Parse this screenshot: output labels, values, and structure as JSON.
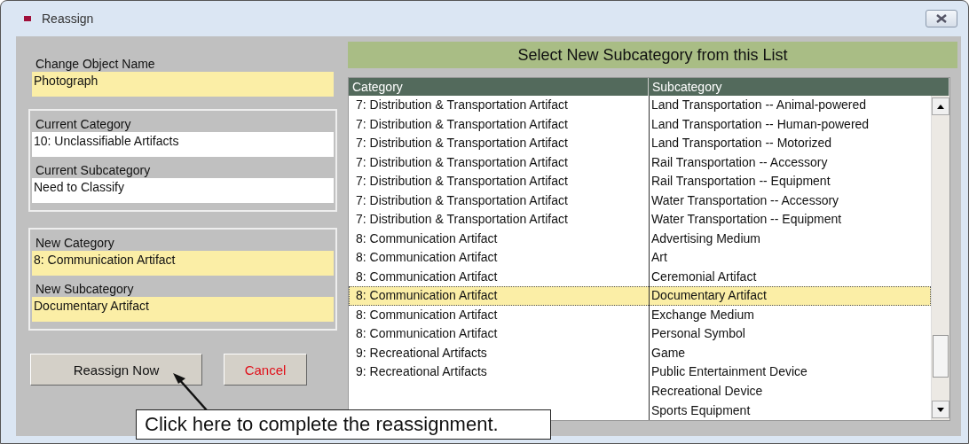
{
  "window": {
    "title": "Reassign"
  },
  "object_name": {
    "label": "Change Object Name",
    "value": "Photograph"
  },
  "current": {
    "category_label": "Current Category",
    "category": "10: Unclassifiable Artifacts",
    "subcategory_label": "Current Subcategory",
    "subcategory": "Need to Classify"
  },
  "new": {
    "category_label": "New Category",
    "category": "8: Communication Artifact",
    "subcategory_label": "New Subcategory",
    "subcategory": "Documentary Artifact"
  },
  "buttons": [
    {
      "label": "Reassign Now",
      "kind": "primary"
    },
    {
      "label": "Cancel",
      "kind": "cancel"
    }
  ],
  "list": {
    "title": "Select New Subcategory from this List",
    "columns": [
      "Category",
      "Subcategory"
    ],
    "rows": [
      {
        "category": "7: Distribution & Transportation Artifact",
        "subcategory": "Land Transportation -- Animal-powered",
        "selected": false
      },
      {
        "category": "7: Distribution & Transportation Artifact",
        "subcategory": "Land Transportation -- Human-powered",
        "selected": false
      },
      {
        "category": "7: Distribution & Transportation Artifact",
        "subcategory": "Land Transportation -- Motorized",
        "selected": false
      },
      {
        "category": "7: Distribution & Transportation Artifact",
        "subcategory": "Rail Transportation -- Accessory",
        "selected": false
      },
      {
        "category": "7: Distribution & Transportation Artifact",
        "subcategory": "Rail Transportation -- Equipment",
        "selected": false
      },
      {
        "category": "7: Distribution & Transportation Artifact",
        "subcategory": "Water Transportation -- Accessory",
        "selected": false
      },
      {
        "category": "7: Distribution & Transportation Artifact",
        "subcategory": "Water Transportation -- Equipment",
        "selected": false
      },
      {
        "category": "8: Communication Artifact",
        "subcategory": "Advertising Medium",
        "selected": false
      },
      {
        "category": "8: Communication Artifact",
        "subcategory": "Art",
        "selected": false
      },
      {
        "category": "8: Communication Artifact",
        "subcategory": "Ceremonial Artifact",
        "selected": false
      },
      {
        "category": "8: Communication Artifact",
        "subcategory": "Documentary Artifact",
        "selected": true
      },
      {
        "category": "8: Communication Artifact",
        "subcategory": "Exchange Medium",
        "selected": false
      },
      {
        "category": "8: Communication Artifact",
        "subcategory": "Personal Symbol",
        "selected": false
      },
      {
        "category": "9: Recreational Artifacts",
        "subcategory": "Game",
        "selected": false
      },
      {
        "category": "9: Recreational Artifacts",
        "subcategory": "Public Entertainment Device",
        "selected": false
      },
      {
        "subcategory": "Recreational Device",
        "selected": false
      },
      {
        "subcategory": "Sports Equipment",
        "selected": false
      }
    ]
  },
  "callout": {
    "text": "Click here to complete the reassignment."
  }
}
